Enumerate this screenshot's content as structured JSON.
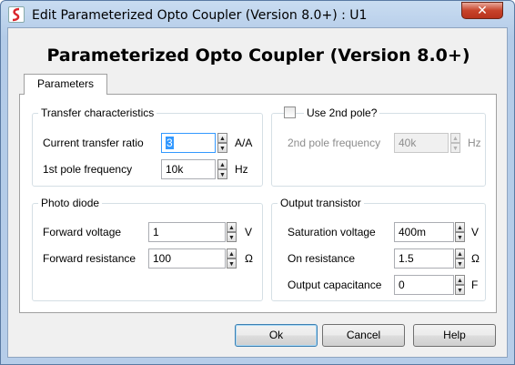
{
  "window": {
    "title": "Edit Parameterized Opto Coupler (Version 8.0+) : U1",
    "close_label": "✕",
    "app_icon": "simetrix-logo-icon",
    "accent_color": "#d9262c"
  },
  "heading": "Parameterized Opto Coupler (Version 8.0+)",
  "tabs": [
    {
      "label": "Parameters",
      "selected": true
    }
  ],
  "transfer": {
    "title": "Transfer characteristics",
    "ctr_label": "Current transfer ratio",
    "ctr_value": "3",
    "ctr_unit": "A/A",
    "pole1_label": "1st pole frequency",
    "pole1_value": "10k",
    "pole1_unit": "Hz"
  },
  "pole2": {
    "checkbox_label": "Use 2nd pole?",
    "checked": false,
    "freq_label": "2nd pole frequency",
    "freq_value": "40k",
    "freq_unit": "Hz"
  },
  "photodiode": {
    "title": "Photo diode",
    "fv_label": "Forward voltage",
    "fv_value": "1",
    "fv_unit": "V",
    "fr_label": "Forward resistance",
    "fr_value": "100",
    "fr_unit": "Ω"
  },
  "transistor": {
    "title": "Output transistor",
    "sat_label": "Saturation voltage",
    "sat_value": "400m",
    "sat_unit": "V",
    "on_label": "On resistance",
    "on_value": "1.5",
    "on_unit": "Ω",
    "cap_label": "Output capacitance",
    "cap_value": "0",
    "cap_unit": "F"
  },
  "buttons": {
    "ok": "Ok",
    "cancel": "Cancel",
    "help": "Help"
  }
}
